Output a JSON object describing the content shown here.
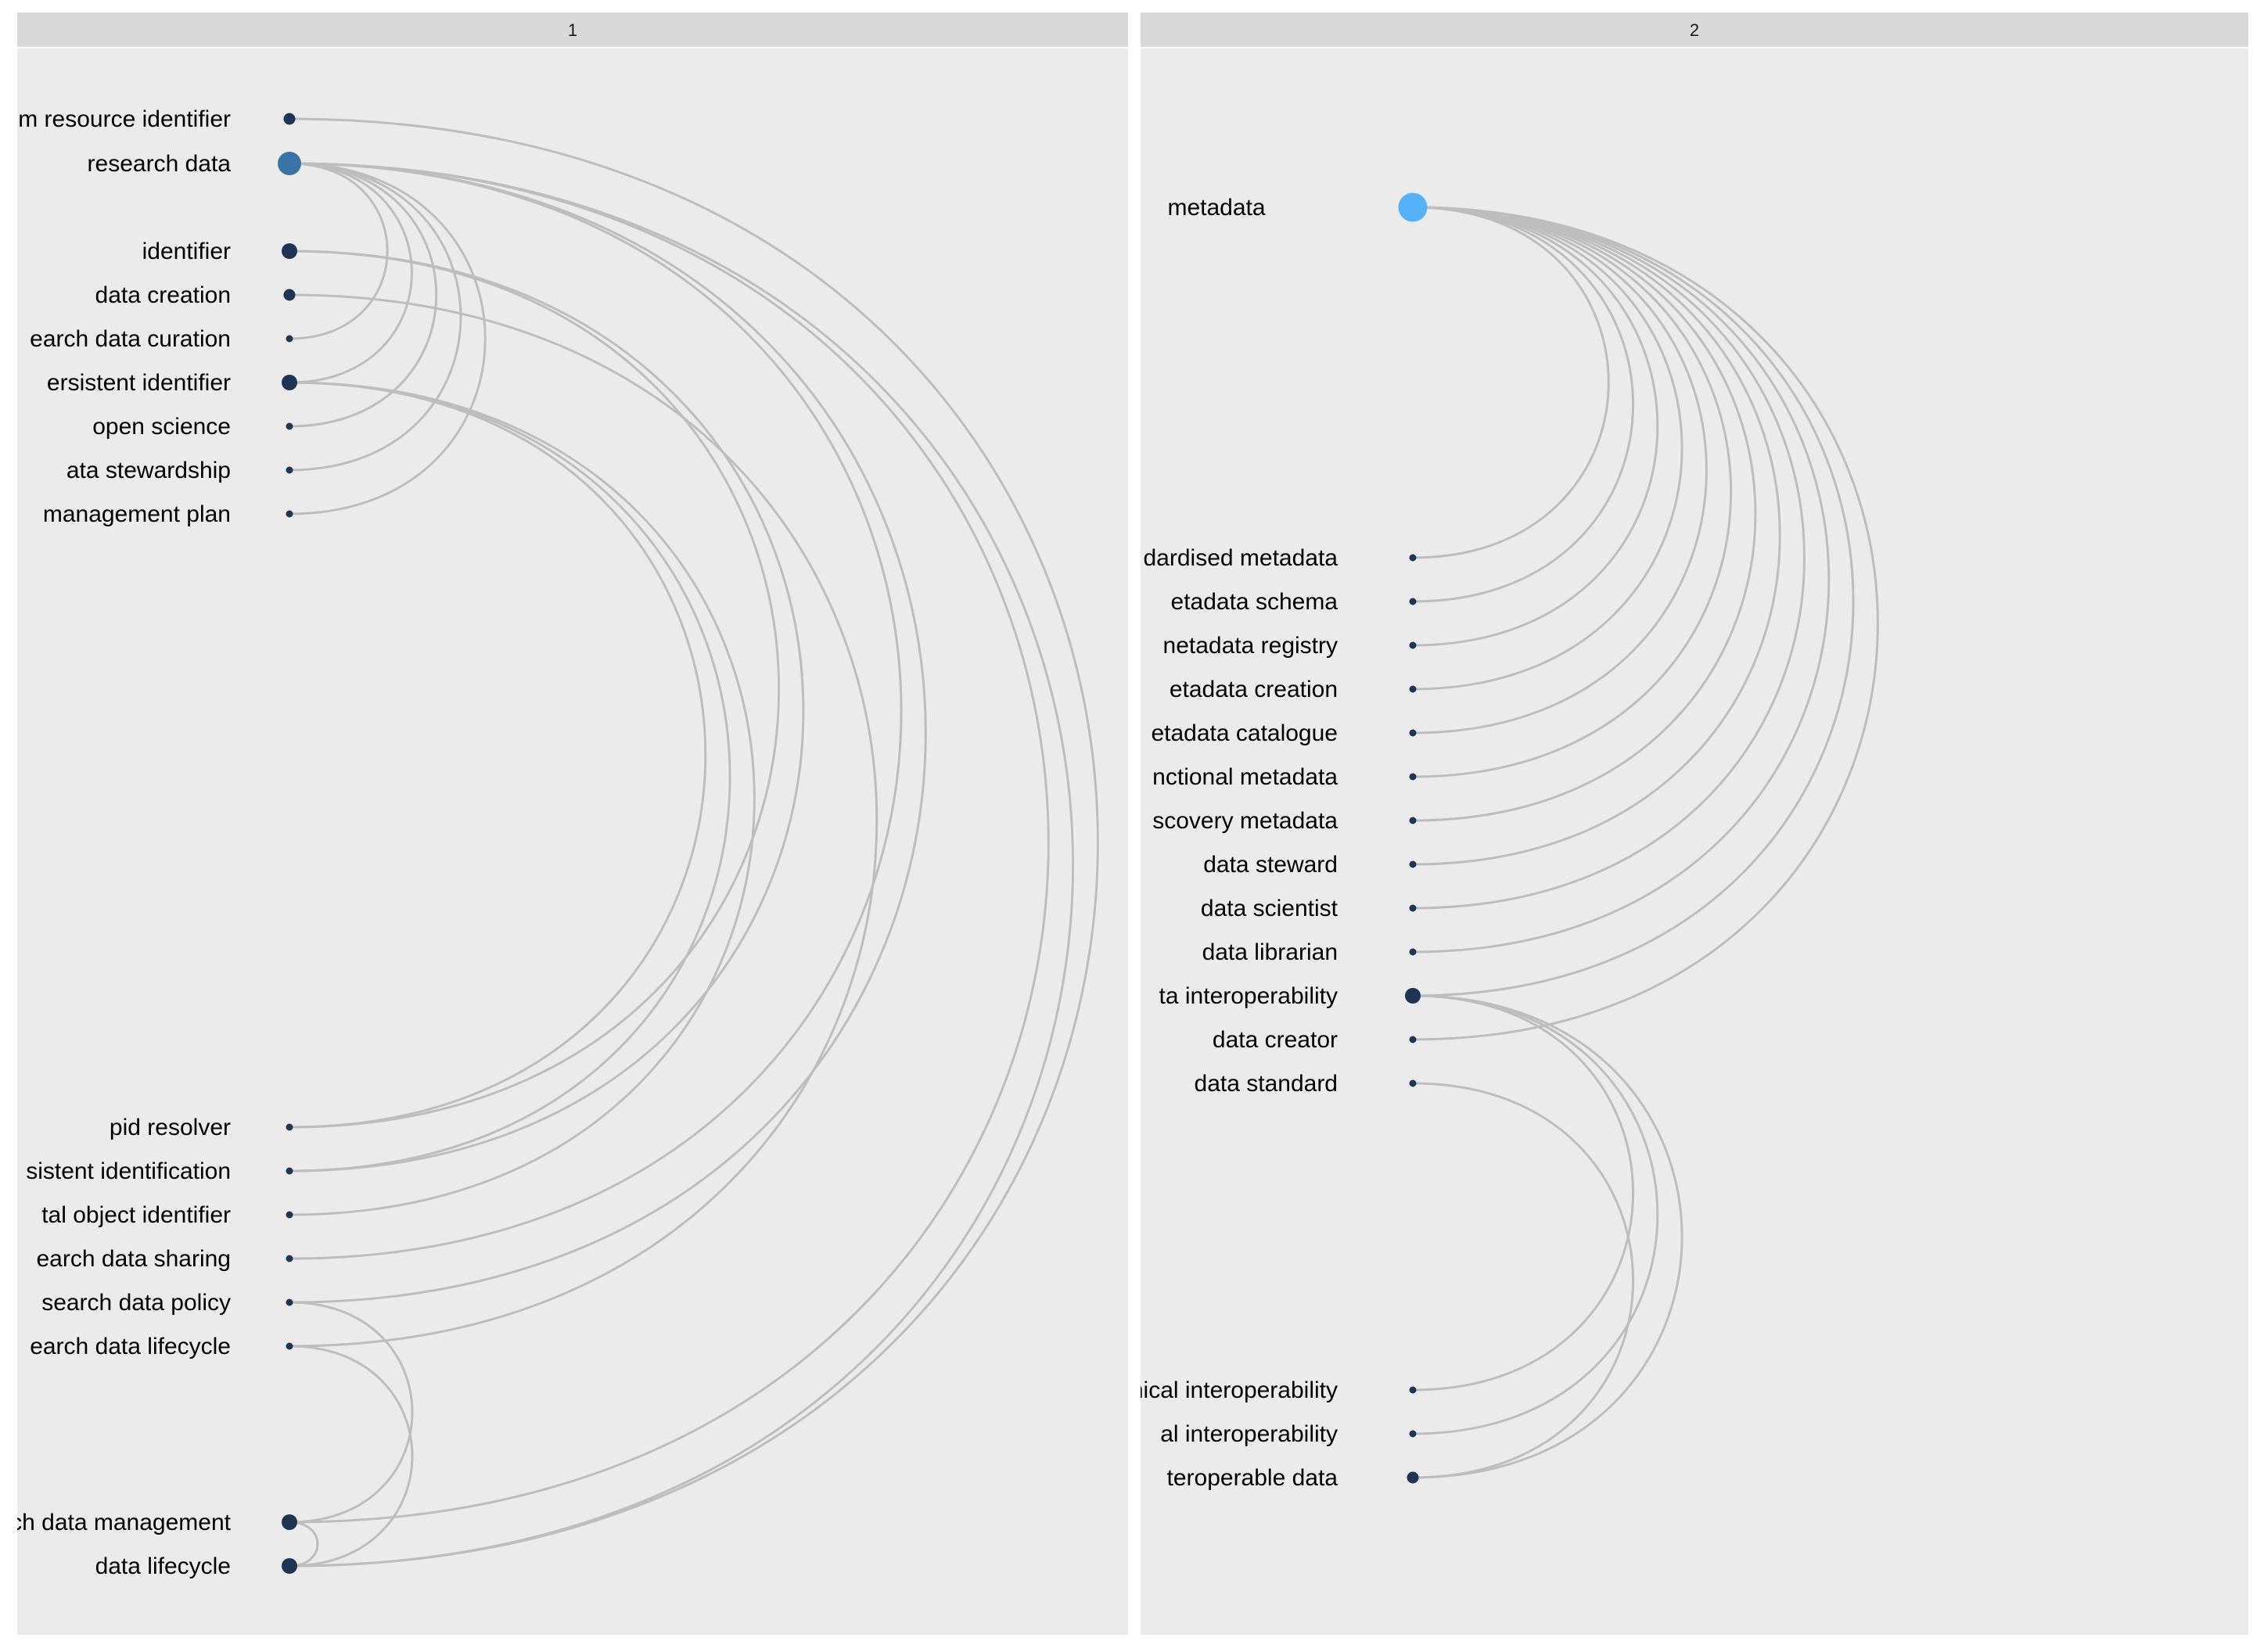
{
  "panels": [
    {
      "strip": "1",
      "nodes": [
        {
          "id": "ari",
          "label": "m resource identifier",
          "size": 1
        },
        {
          "id": "rd",
          "label": "research data",
          "size": 3,
          "color": "#3a73a8"
        },
        {
          "id": "idf",
          "label": "identifier",
          "size": 2
        },
        {
          "id": "dc",
          "label": "data creation",
          "size": 1
        },
        {
          "id": "rdc",
          "label": "earch data curation",
          "size": 0
        },
        {
          "id": "pid",
          "label": "ersistent identifier",
          "size": 2
        },
        {
          "id": "os",
          "label": "open science",
          "size": 0
        },
        {
          "id": "ds",
          "label": "ata stewardship",
          "size": 0
        },
        {
          "id": "dmp",
          "label": "management plan",
          "size": 0
        },
        {
          "id": "pr",
          "label": "pid resolver",
          "size": 0
        },
        {
          "id": "pi",
          "label": "sistent identification",
          "size": 0
        },
        {
          "id": "doi",
          "label": "tal object identifier",
          "size": 0
        },
        {
          "id": "rds",
          "label": "earch data sharing",
          "size": 0
        },
        {
          "id": "rdp",
          "label": "search data policy",
          "size": 0
        },
        {
          "id": "rdl",
          "label": "earch data lifecycle",
          "size": 0
        },
        {
          "id": "rdm",
          "label": "ch data management",
          "size": 2
        },
        {
          "id": "dl",
          "label": "data lifecycle",
          "size": 2
        }
      ],
      "edges": [
        [
          "ari",
          "dl"
        ],
        [
          "rd",
          "rdc"
        ],
        [
          "rd",
          "pid"
        ],
        [
          "rd",
          "os"
        ],
        [
          "rd",
          "ds"
        ],
        [
          "rd",
          "dmp"
        ],
        [
          "rd",
          "rdm"
        ],
        [
          "rd",
          "dl"
        ],
        [
          "rd",
          "rds"
        ],
        [
          "rd",
          "rdp"
        ],
        [
          "idf",
          "pr"
        ],
        [
          "idf",
          "pi"
        ],
        [
          "dc",
          "rdl"
        ],
        [
          "pid",
          "pr"
        ],
        [
          "pid",
          "pi"
        ],
        [
          "pid",
          "doi"
        ],
        [
          "rdp",
          "rdm"
        ],
        [
          "rdl",
          "dl"
        ],
        [
          "rdm",
          "dl"
        ]
      ]
    },
    {
      "strip": "2",
      "nodes": [
        {
          "id": "meta",
          "label": "metadata",
          "size": 4,
          "color": "#56b1f7"
        },
        {
          "id": "sm",
          "label": "dardised metadata",
          "size": 0
        },
        {
          "id": "ms",
          "label": "etadata schema",
          "size": 0
        },
        {
          "id": "mr",
          "label": "netadata registry",
          "size": 0
        },
        {
          "id": "mc",
          "label": "etadata creation",
          "size": 0
        },
        {
          "id": "mcat",
          "label": "etadata catalogue",
          "size": 0
        },
        {
          "id": "fm",
          "label": "nctional metadata",
          "size": 0
        },
        {
          "id": "dm",
          "label": "scovery metadata",
          "size": 0
        },
        {
          "id": "dst",
          "label": "data steward",
          "size": 0
        },
        {
          "id": "dsc",
          "label": "data scientist",
          "size": 0
        },
        {
          "id": "dlb",
          "label": "data librarian",
          "size": 0
        },
        {
          "id": "di",
          "label": "ta interoperability",
          "size": 2
        },
        {
          "id": "dcr",
          "label": "data creator",
          "size": 0
        },
        {
          "id": "dstd",
          "label": "data standard",
          "size": 0
        },
        {
          "id": "ti",
          "label": "nical interoperability",
          "size": 0
        },
        {
          "id": "si",
          "label": "al interoperability",
          "size": 0
        },
        {
          "id": "id",
          "label": "teroperable data",
          "size": 1
        }
      ],
      "edges": [
        [
          "meta",
          "sm"
        ],
        [
          "meta",
          "ms"
        ],
        [
          "meta",
          "mr"
        ],
        [
          "meta",
          "mc"
        ],
        [
          "meta",
          "mcat"
        ],
        [
          "meta",
          "fm"
        ],
        [
          "meta",
          "dm"
        ],
        [
          "meta",
          "dst"
        ],
        [
          "meta",
          "dsc"
        ],
        [
          "meta",
          "dlb"
        ],
        [
          "meta",
          "di"
        ],
        [
          "meta",
          "dcr"
        ],
        [
          "di",
          "ti"
        ],
        [
          "di",
          "si"
        ],
        [
          "di",
          "id"
        ],
        [
          "dstd",
          "id"
        ]
      ]
    }
  ],
  "colors": {
    "panel_bg": "#ebebeb",
    "strip_bg": "#d9d9d9",
    "edge": "#bdbdbd",
    "node_default": "#1f3553"
  }
}
